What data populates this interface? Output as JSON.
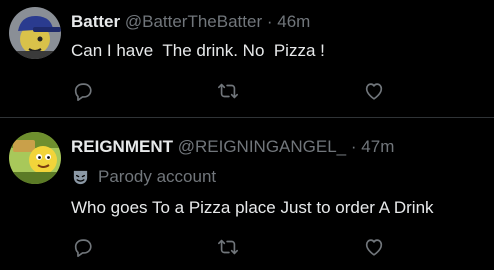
{
  "tweets": [
    {
      "name": "Batter",
      "handle": "@BatterTheBatter",
      "separator": "·",
      "time": "46m",
      "text": "Can I have  The drink. No  Pizza !",
      "avatar_icon": "baseball-cap-avatar"
    },
    {
      "name": "REIGNMENT",
      "handle": "@REIGNINGANGEL_",
      "separator": "·",
      "time": "47m",
      "label": "Parody account",
      "label_icon": "theater-mask-icon",
      "text": "Who goes To a Pizza place Just to order A Drink",
      "avatar_icon": "cartoon-avatar"
    }
  ],
  "actions": {
    "reply_icon": "reply-icon",
    "retweet_icon": "retweet-icon",
    "like_icon": "heart-icon"
  },
  "colors": {
    "background": "#000000",
    "primary_text": "#e7e9ea",
    "secondary_text": "#71767b",
    "divider": "#2f3336"
  }
}
